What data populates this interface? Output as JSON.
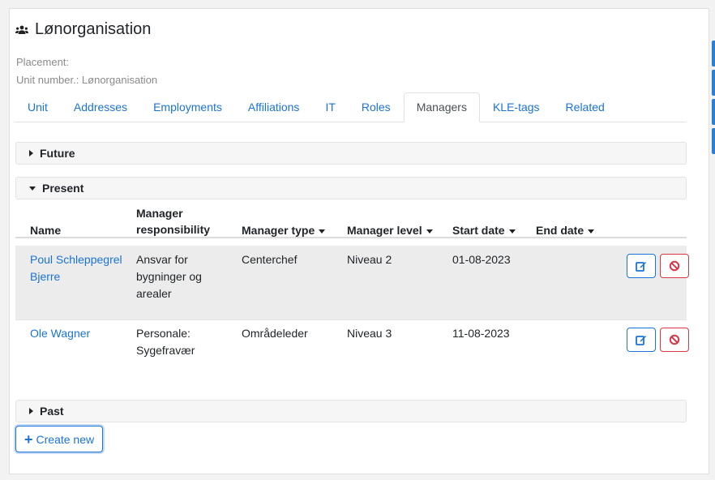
{
  "header": {
    "title": "Lønorganisation",
    "placement_label": "Placement:",
    "unit_number_label": "Unit number.: Lønorganisation"
  },
  "tabs": [
    {
      "label": "Unit"
    },
    {
      "label": "Addresses"
    },
    {
      "label": "Employments"
    },
    {
      "label": "Affiliations"
    },
    {
      "label": "IT"
    },
    {
      "label": "Roles"
    },
    {
      "label": "Managers",
      "active": true
    },
    {
      "label": "KLE-tags"
    },
    {
      "label": "Related"
    }
  ],
  "sections": {
    "future": "Future",
    "present": "Present",
    "past": "Past"
  },
  "table": {
    "columns": {
      "name": "Name",
      "responsibility_line1": "Manager",
      "responsibility_line2": "responsibility",
      "type": "Manager type",
      "level": "Manager level",
      "start": "Start date",
      "end": "End date"
    },
    "rows": [
      {
        "name_line1": "Poul Schleppegrel",
        "name_line2": "Bjerre",
        "resp_line1": "Ansvar for",
        "resp_line2": "bygninger og",
        "resp_line3": "arealer",
        "type": "Centerchef",
        "level": "Niveau 2",
        "start": "01-08-2023",
        "end": ""
      },
      {
        "name_line1": "Ole Wagner",
        "resp_line1": "Personale:",
        "resp_line2": "Sygefravær",
        "type": "Områdeleder",
        "level": "Niveau 3",
        "start": "11-08-2023",
        "end": ""
      }
    ]
  },
  "actions": {
    "create_new": "Create new",
    "edit_icon": "edit-icon",
    "delete_icon": "ban-icon"
  },
  "colors": {
    "link": "#1a73d8",
    "danger": "#dc3545",
    "section_bg": "#f6f6f6",
    "row_shaded": "#ececec"
  }
}
